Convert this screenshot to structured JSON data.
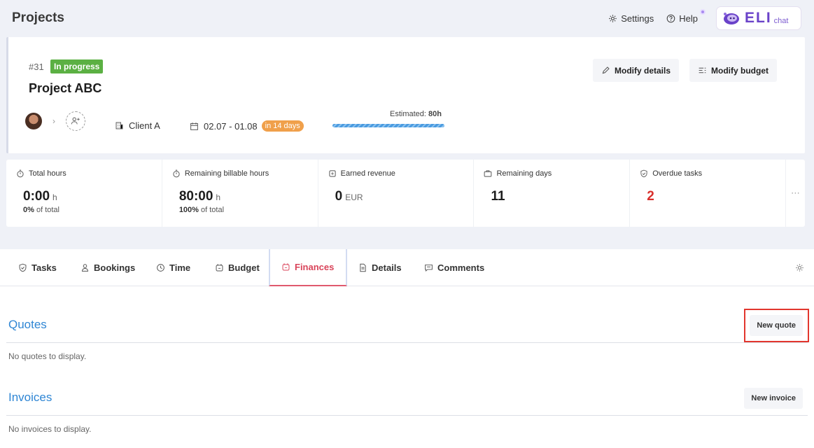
{
  "header": {
    "title": "Projects",
    "settings_label": "Settings",
    "help_label": "Help",
    "eli_brand": "ELI",
    "eli_sub": "chat"
  },
  "project": {
    "number": "#31",
    "status": "In progress",
    "name": "Project ABC",
    "modify_details": "Modify details",
    "modify_budget": "Modify budget",
    "client": "Client A",
    "dates": "02.07 - 01.08",
    "due_badge": "in 14 days",
    "estimated_label": "Estimated:",
    "estimated_value": "80h",
    "estimated_progress": 1.0
  },
  "stats": [
    {
      "label": "Total hours",
      "value": "0:00",
      "unit": "h",
      "sub_pct": "0%",
      "sub_text": "of total",
      "icon": "stopwatch-icon"
    },
    {
      "label": "Remaining billable hours",
      "value": "80:00",
      "unit": "h",
      "sub_pct": "100%",
      "sub_text": "of total",
      "icon": "stopwatch-icon"
    },
    {
      "label": "Earned revenue",
      "value": "0",
      "unit": "EUR",
      "icon": "coins-icon"
    },
    {
      "label": "Remaining days",
      "value": "11",
      "icon": "briefcase-icon"
    },
    {
      "label": "Overdue tasks",
      "value": "2",
      "icon": "check-shield-icon",
      "value_color": "#d9302c"
    }
  ],
  "tabs": [
    {
      "label": "Tasks"
    },
    {
      "label": "Bookings"
    },
    {
      "label": "Time"
    },
    {
      "label": "Budget"
    },
    {
      "label": "Finances"
    },
    {
      "label": "Details"
    },
    {
      "label": "Comments"
    }
  ],
  "quotes": {
    "title": "Quotes",
    "button": "New quote",
    "empty": "No quotes to display."
  },
  "invoices": {
    "title": "Invoices",
    "button": "New invoice",
    "empty": "No invoices to display."
  },
  "colors": {
    "accent_blue": "#2f86d4",
    "status_green": "#5bb043",
    "due_orange": "#f0a04b",
    "active_tab": "#d9445a",
    "overdue_red": "#d9302c",
    "highlight": "#e2362e"
  }
}
